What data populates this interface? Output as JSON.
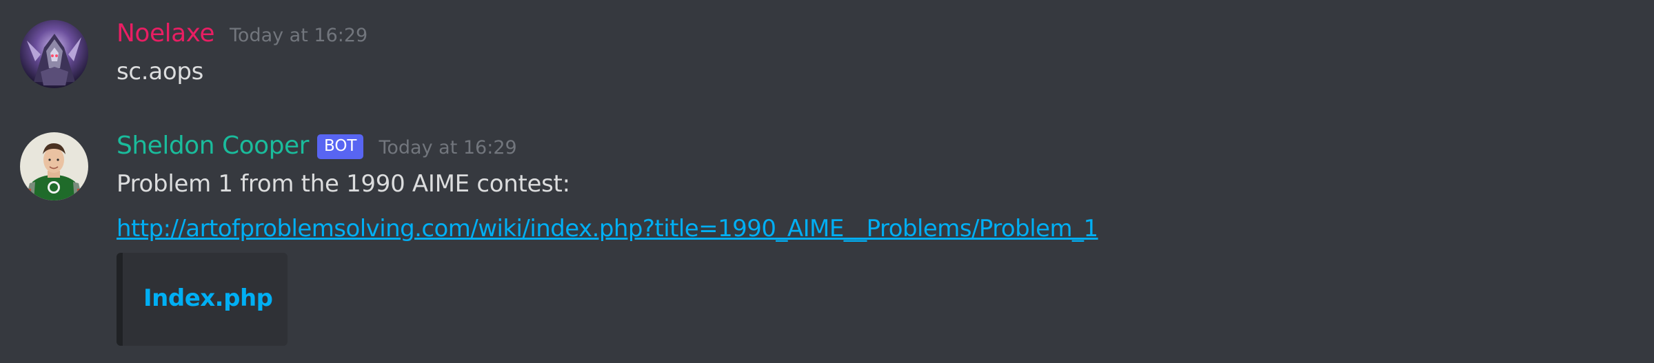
{
  "colors": {
    "background": "#36393f",
    "user1_name": "#e91e63",
    "user2_name": "#1abc9c",
    "link": "#00aff4",
    "bot_tag": "#5865f2",
    "timestamp": "#72767d",
    "text": "#dcddde",
    "embed_bg": "#2f3136"
  },
  "messages": [
    {
      "username": "Noelaxe",
      "timestamp": "Today at 16:29",
      "text": "sc.aops",
      "avatar_icon": "warrior-avatar-icon"
    },
    {
      "username": "Sheldon Cooper",
      "bot_tag": "BOT",
      "timestamp": "Today at 16:29",
      "text": "Problem 1 from the 1990 AIME  contest:",
      "link": "http://artofproblemsolving.com/wiki/index.php?title=1990_AIME__Problems/Problem_1",
      "embed_title": "Index.php",
      "avatar_icon": "sheldon-avatar-icon"
    }
  ]
}
